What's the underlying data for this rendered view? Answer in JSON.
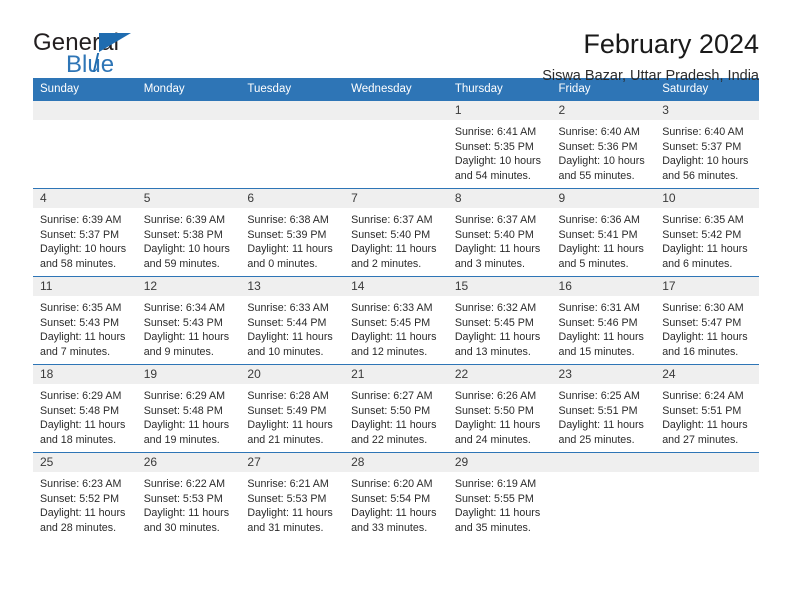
{
  "brand": {
    "name_part1": "General",
    "name_part2": "Blue"
  },
  "header": {
    "title": "February 2024",
    "location": "Siswa Bazar, Uttar Pradesh, India"
  },
  "colors": {
    "header_blue": "#2e75b6",
    "daynum_gray": "#efefef",
    "text": "#2b2b2b"
  },
  "weekdays": [
    "Sunday",
    "Monday",
    "Tuesday",
    "Wednesday",
    "Thursday",
    "Friday",
    "Saturday"
  ],
  "labels": {
    "sunrise_prefix": "Sunrise:",
    "sunset_prefix": "Sunset:",
    "daylight_prefix": "Daylight:"
  },
  "weeks": [
    [
      {
        "day": "",
        "empty": true
      },
      {
        "day": "",
        "empty": true
      },
      {
        "day": "",
        "empty": true
      },
      {
        "day": "",
        "empty": true
      },
      {
        "day": "1",
        "sunrise": "Sunrise: 6:41 AM",
        "sunset": "Sunset: 5:35 PM",
        "daylight": "Daylight: 10 hours and 54 minutes."
      },
      {
        "day": "2",
        "sunrise": "Sunrise: 6:40 AM",
        "sunset": "Sunset: 5:36 PM",
        "daylight": "Daylight: 10 hours and 55 minutes."
      },
      {
        "day": "3",
        "sunrise": "Sunrise: 6:40 AM",
        "sunset": "Sunset: 5:37 PM",
        "daylight": "Daylight: 10 hours and 56 minutes."
      }
    ],
    [
      {
        "day": "4",
        "sunrise": "Sunrise: 6:39 AM",
        "sunset": "Sunset: 5:37 PM",
        "daylight": "Daylight: 10 hours and 58 minutes."
      },
      {
        "day": "5",
        "sunrise": "Sunrise: 6:39 AM",
        "sunset": "Sunset: 5:38 PM",
        "daylight": "Daylight: 10 hours and 59 minutes."
      },
      {
        "day": "6",
        "sunrise": "Sunrise: 6:38 AM",
        "sunset": "Sunset: 5:39 PM",
        "daylight": "Daylight: 11 hours and 0 minutes."
      },
      {
        "day": "7",
        "sunrise": "Sunrise: 6:37 AM",
        "sunset": "Sunset: 5:40 PM",
        "daylight": "Daylight: 11 hours and 2 minutes."
      },
      {
        "day": "8",
        "sunrise": "Sunrise: 6:37 AM",
        "sunset": "Sunset: 5:40 PM",
        "daylight": "Daylight: 11 hours and 3 minutes."
      },
      {
        "day": "9",
        "sunrise": "Sunrise: 6:36 AM",
        "sunset": "Sunset: 5:41 PM",
        "daylight": "Daylight: 11 hours and 5 minutes."
      },
      {
        "day": "10",
        "sunrise": "Sunrise: 6:35 AM",
        "sunset": "Sunset: 5:42 PM",
        "daylight": "Daylight: 11 hours and 6 minutes."
      }
    ],
    [
      {
        "day": "11",
        "sunrise": "Sunrise: 6:35 AM",
        "sunset": "Sunset: 5:43 PM",
        "daylight": "Daylight: 11 hours and 7 minutes."
      },
      {
        "day": "12",
        "sunrise": "Sunrise: 6:34 AM",
        "sunset": "Sunset: 5:43 PM",
        "daylight": "Daylight: 11 hours and 9 minutes."
      },
      {
        "day": "13",
        "sunrise": "Sunrise: 6:33 AM",
        "sunset": "Sunset: 5:44 PM",
        "daylight": "Daylight: 11 hours and 10 minutes."
      },
      {
        "day": "14",
        "sunrise": "Sunrise: 6:33 AM",
        "sunset": "Sunset: 5:45 PM",
        "daylight": "Daylight: 11 hours and 12 minutes."
      },
      {
        "day": "15",
        "sunrise": "Sunrise: 6:32 AM",
        "sunset": "Sunset: 5:45 PM",
        "daylight": "Daylight: 11 hours and 13 minutes."
      },
      {
        "day": "16",
        "sunrise": "Sunrise: 6:31 AM",
        "sunset": "Sunset: 5:46 PM",
        "daylight": "Daylight: 11 hours and 15 minutes."
      },
      {
        "day": "17",
        "sunrise": "Sunrise: 6:30 AM",
        "sunset": "Sunset: 5:47 PM",
        "daylight": "Daylight: 11 hours and 16 minutes."
      }
    ],
    [
      {
        "day": "18",
        "sunrise": "Sunrise: 6:29 AM",
        "sunset": "Sunset: 5:48 PM",
        "daylight": "Daylight: 11 hours and 18 minutes."
      },
      {
        "day": "19",
        "sunrise": "Sunrise: 6:29 AM",
        "sunset": "Sunset: 5:48 PM",
        "daylight": "Daylight: 11 hours and 19 minutes."
      },
      {
        "day": "20",
        "sunrise": "Sunrise: 6:28 AM",
        "sunset": "Sunset: 5:49 PM",
        "daylight": "Daylight: 11 hours and 21 minutes."
      },
      {
        "day": "21",
        "sunrise": "Sunrise: 6:27 AM",
        "sunset": "Sunset: 5:50 PM",
        "daylight": "Daylight: 11 hours and 22 minutes."
      },
      {
        "day": "22",
        "sunrise": "Sunrise: 6:26 AM",
        "sunset": "Sunset: 5:50 PM",
        "daylight": "Daylight: 11 hours and 24 minutes."
      },
      {
        "day": "23",
        "sunrise": "Sunrise: 6:25 AM",
        "sunset": "Sunset: 5:51 PM",
        "daylight": "Daylight: 11 hours and 25 minutes."
      },
      {
        "day": "24",
        "sunrise": "Sunrise: 6:24 AM",
        "sunset": "Sunset: 5:51 PM",
        "daylight": "Daylight: 11 hours and 27 minutes."
      }
    ],
    [
      {
        "day": "25",
        "sunrise": "Sunrise: 6:23 AM",
        "sunset": "Sunset: 5:52 PM",
        "daylight": "Daylight: 11 hours and 28 minutes."
      },
      {
        "day": "26",
        "sunrise": "Sunrise: 6:22 AM",
        "sunset": "Sunset: 5:53 PM",
        "daylight": "Daylight: 11 hours and 30 minutes."
      },
      {
        "day": "27",
        "sunrise": "Sunrise: 6:21 AM",
        "sunset": "Sunset: 5:53 PM",
        "daylight": "Daylight: 11 hours and 31 minutes."
      },
      {
        "day": "28",
        "sunrise": "Sunrise: 6:20 AM",
        "sunset": "Sunset: 5:54 PM",
        "daylight": "Daylight: 11 hours and 33 minutes."
      },
      {
        "day": "29",
        "sunrise": "Sunrise: 6:19 AM",
        "sunset": "Sunset: 5:55 PM",
        "daylight": "Daylight: 11 hours and 35 minutes."
      },
      {
        "day": "",
        "empty": true
      },
      {
        "day": "",
        "empty": true
      }
    ]
  ]
}
